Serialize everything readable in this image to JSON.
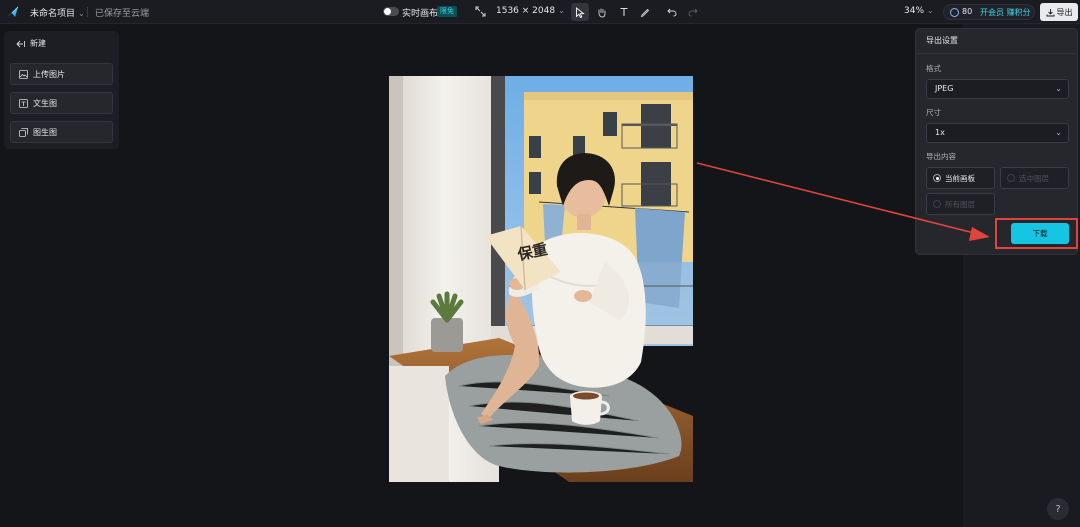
{
  "header": {
    "project_name": "未命名项目",
    "saved_status": "已保存至云端",
    "realtime_canvas_label": "实时画布",
    "free_badge": "限免",
    "canvas_size": "1536 × 2048",
    "zoom": "34%",
    "credits": "80",
    "membership_link": "开会员 赚积分",
    "export_label": "导出"
  },
  "left_panel": {
    "new_label": "新建",
    "items": [
      {
        "label": "上传图片",
        "icon": "upload-image-icon"
      },
      {
        "label": "文生图",
        "icon": "text-to-image-icon"
      },
      {
        "label": "图生图",
        "icon": "image-to-image-icon"
      }
    ]
  },
  "canvas": {
    "book_text": "保重"
  },
  "export_panel": {
    "title": "导出设置",
    "format_label": "格式",
    "format_value": "JPEG",
    "size_label": "尺寸",
    "size_value": "1x",
    "content_label": "导出内容",
    "options": [
      {
        "label": "当前画板",
        "selected": true,
        "enabled": true
      },
      {
        "label": "选中图层",
        "selected": false,
        "enabled": false
      },
      {
        "label": "所有图层",
        "selected": false,
        "enabled": false
      }
    ],
    "download_label": "下载"
  },
  "colors": {
    "accent": "#14c6e2",
    "annotation_red": "#e0443e",
    "background": "#141519"
  }
}
